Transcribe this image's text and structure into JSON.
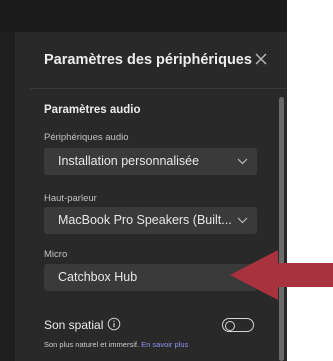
{
  "dialog": {
    "title": "Paramètres des périphériques",
    "close_icon": "close-icon"
  },
  "audio": {
    "section_title": "Paramètres audio",
    "devices_label": "Périphériques audio",
    "devices_value": "Installation personnalisée",
    "speaker_label": "Haut-parleur",
    "speaker_value": "MacBook Pro Speakers (Built...",
    "mic_label": "Micro",
    "mic_value": "Catchbox Hub"
  },
  "spatial": {
    "label": "Son spatial",
    "info_icon": "info-icon",
    "toggle_on": false,
    "description": "Son plus naturel et immersif.",
    "link": "En savoir plus"
  },
  "annotation": {
    "arrow_color": "#a8323e",
    "icon": "red-arrow-icon"
  },
  "colors": {
    "panel_bg": "#292929",
    "dropdown_bg": "#3a3a3a",
    "link": "#8f95ee"
  }
}
